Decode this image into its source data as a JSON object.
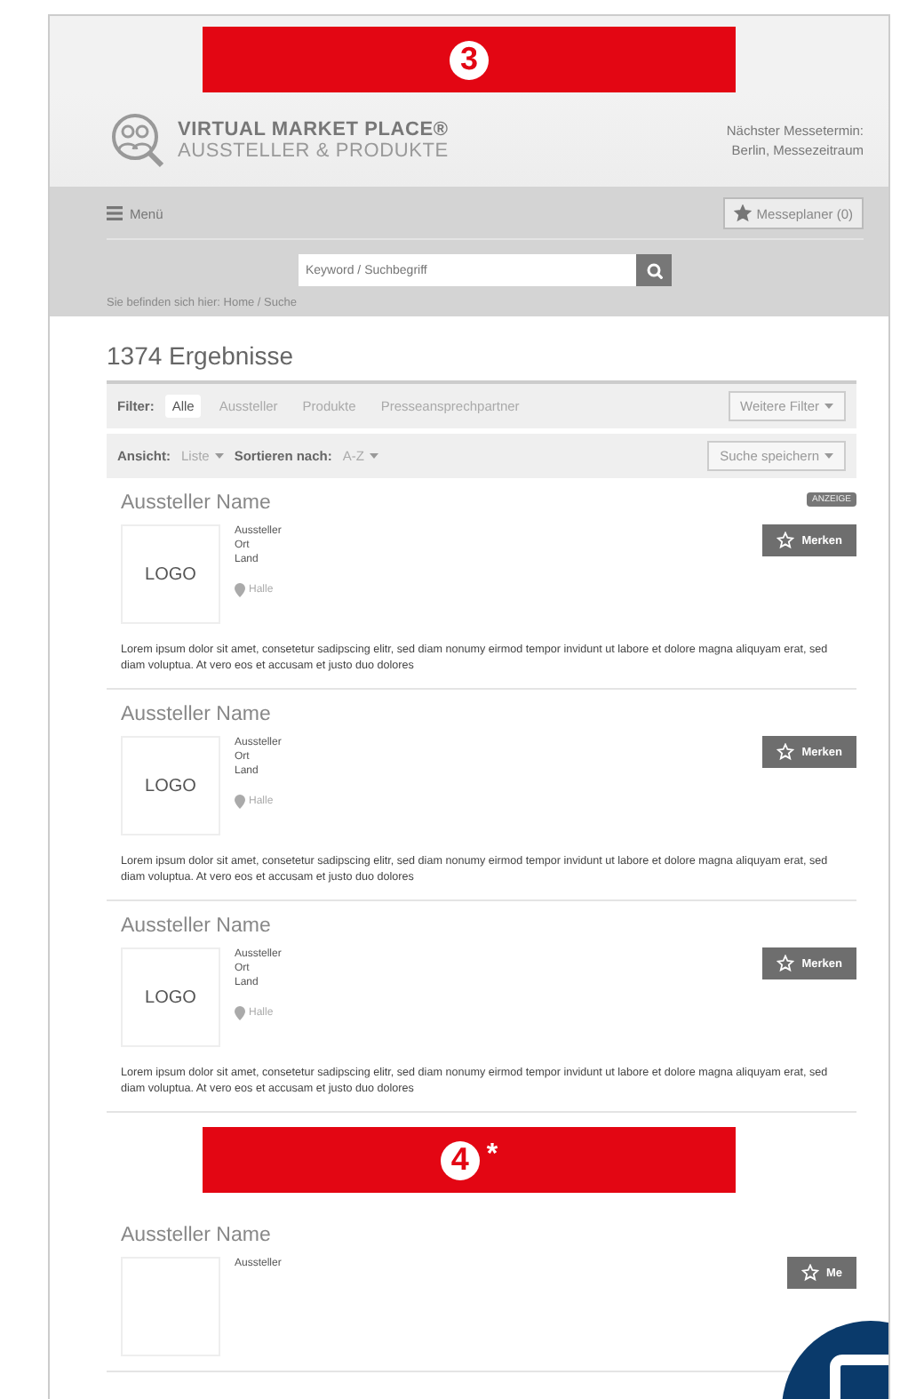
{
  "top_banner": {
    "number": "3"
  },
  "header": {
    "brand": "VIRTUAL MARKET PLACE®",
    "subtitle": "AUSSTELLER & PRODUKTE",
    "next_fair_label": "Nächster Messetermin:",
    "next_fair_value": "Berlin, Messezeitraum"
  },
  "nav": {
    "menu": "Menü",
    "planner": "Messeplaner (0)",
    "search_placeholder": "Keyword / Suchbegriff",
    "breadcrumb": "Sie befinden sich hier:  Home  /  Suche"
  },
  "results_title": "1374 Ergebnisse",
  "filter": {
    "label": "Filter:",
    "tabs": [
      {
        "label": "Alle",
        "selected": true
      },
      {
        "label": "Aussteller",
        "selected": false
      },
      {
        "label": "Produkte",
        "selected": false
      },
      {
        "label": "Presseansprechpartner",
        "selected": false
      }
    ],
    "more": "Weitere Filter"
  },
  "view": {
    "view_label": "Ansicht:",
    "view_value": "Liste",
    "sort_label": "Sortieren nach:",
    "sort_value": "A-Z",
    "save": "Suche speichern"
  },
  "cards": [
    {
      "name": "Aussteller Name",
      "badge": "ANZEIGE",
      "logo": "LOGO",
      "lines": [
        "Aussteller",
        "Ort",
        "Land"
      ],
      "hall": "Halle",
      "button": "Merken",
      "text": "Lorem ipsum dolor sit amet, consetetur sadipscing elitr, sed diam nonumy eirmod tempor invidunt ut labore et dolore magna aliquyam erat, sed diam voluptua. At vero eos et accusam et justo duo dolores"
    },
    {
      "name": "Aussteller Name",
      "logo": "LOGO",
      "lines": [
        "Aussteller",
        "Ort",
        "Land"
      ],
      "hall": "Halle",
      "button": "Merken",
      "text": "Lorem ipsum dolor sit amet, consetetur sadipscing elitr, sed diam nonumy eirmod tempor invidunt ut labore et dolore magna aliquyam erat, sed diam voluptua. At vero eos et accusam et justo duo dolores"
    },
    {
      "name": "Aussteller Name",
      "logo": "LOGO",
      "lines": [
        "Aussteller",
        "Ort",
        "Land"
      ],
      "hall": "Halle",
      "button": "Merken",
      "text": "Lorem ipsum dolor sit amet, consetetur sadipscing elitr, sed diam nonumy eirmod tempor invidunt ut labore et dolore magna aliquyam erat, sed diam voluptua. At vero eos et accusam et justo duo dolores"
    }
  ],
  "mid_banner": {
    "number": "4",
    "mark": "*"
  },
  "partial_card": {
    "name": "Aussteller Name",
    "lines": [
      "Aussteller"
    ],
    "button": "Me"
  }
}
